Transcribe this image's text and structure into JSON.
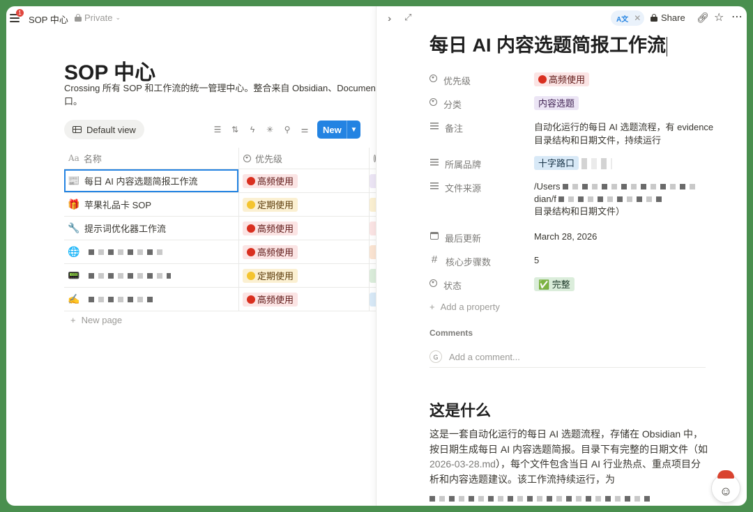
{
  "left": {
    "workspace_title": "SOP 中心",
    "privacy": "Private",
    "notification_count": "1",
    "page_title": "SOP 中心",
    "description": "Crossing 所有 SOP 和工作流的统一管理中心。整合来自 Obsidian、Documents 口。",
    "view_tab": "Default view",
    "new_button": "New",
    "columns": {
      "name": "名称",
      "priority": "优先级"
    },
    "rows": [
      {
        "emoji": "📰",
        "name": "每日 AI 内容选题简报工作流",
        "priority": "高频使用",
        "priority_color": "red",
        "sliver": "#ece5f5"
      },
      {
        "emoji": "🎁",
        "name": "苹果礼品卡 SOP",
        "priority": "定期使用",
        "priority_color": "yellow",
        "sliver": "#fbf0d2"
      },
      {
        "emoji": "🔧",
        "name": "提示词优化器工作流",
        "priority": "高频使用",
        "priority_color": "red",
        "sliver": "#fbe4e4"
      },
      {
        "emoji": "🌐",
        "name": "",
        "priority": "高频使用",
        "priority_color": "red",
        "sliver": "#fbe4d2"
      },
      {
        "emoji": "📟",
        "name": "",
        "priority": "定期使用",
        "priority_color": "yellow",
        "sliver": "#dbeddb"
      },
      {
        "emoji": "✍️",
        "name": "",
        "priority": "高频使用",
        "priority_color": "red",
        "sliver": "#d8e9f7"
      }
    ],
    "new_page": "New page"
  },
  "right": {
    "translate_label": "A文",
    "share": "Share",
    "title": "每日 AI 内容选题简报工作流",
    "properties": {
      "priority": {
        "label": "优先级",
        "value": "高频使用"
      },
      "category": {
        "label": "分类",
        "value": "内容选题"
      },
      "note": {
        "label": "备注",
        "value": "自动化运行的每日 AI 选题流程，有 evidence 目录结构和日期文件，持续运行"
      },
      "brand": {
        "label": "所属品牌",
        "value": "十字路口"
      },
      "source": {
        "label": "文件来源",
        "line1": "/Users",
        "line2": "dian/f",
        "line3": "目录结构和日期文件）"
      },
      "updated": {
        "label": "最后更新",
        "value": "March 28, 2026"
      },
      "steps": {
        "label": "核心步骤数",
        "value": "5"
      },
      "status": {
        "label": "状态",
        "value": "✅ 完整"
      }
    },
    "add_property": "Add a property",
    "comments_heading": "Comments",
    "avatar_letter": "G",
    "comment_placeholder": "Add a comment...",
    "section_heading": "这是什么",
    "paragraph_a": "这是一套自动化运行的每日 AI 选题流程，存储在 Obsidian 中，按日期生成每日 AI 内容选题简报。目录下有完整的日期文件（如 ",
    "paragraph_code": "2026-03-28.md",
    "paragraph_b": "），每个文件包含当日 AI 行业热点、重点项目分析和内容选题建议。该工作流持续运行，为"
  }
}
